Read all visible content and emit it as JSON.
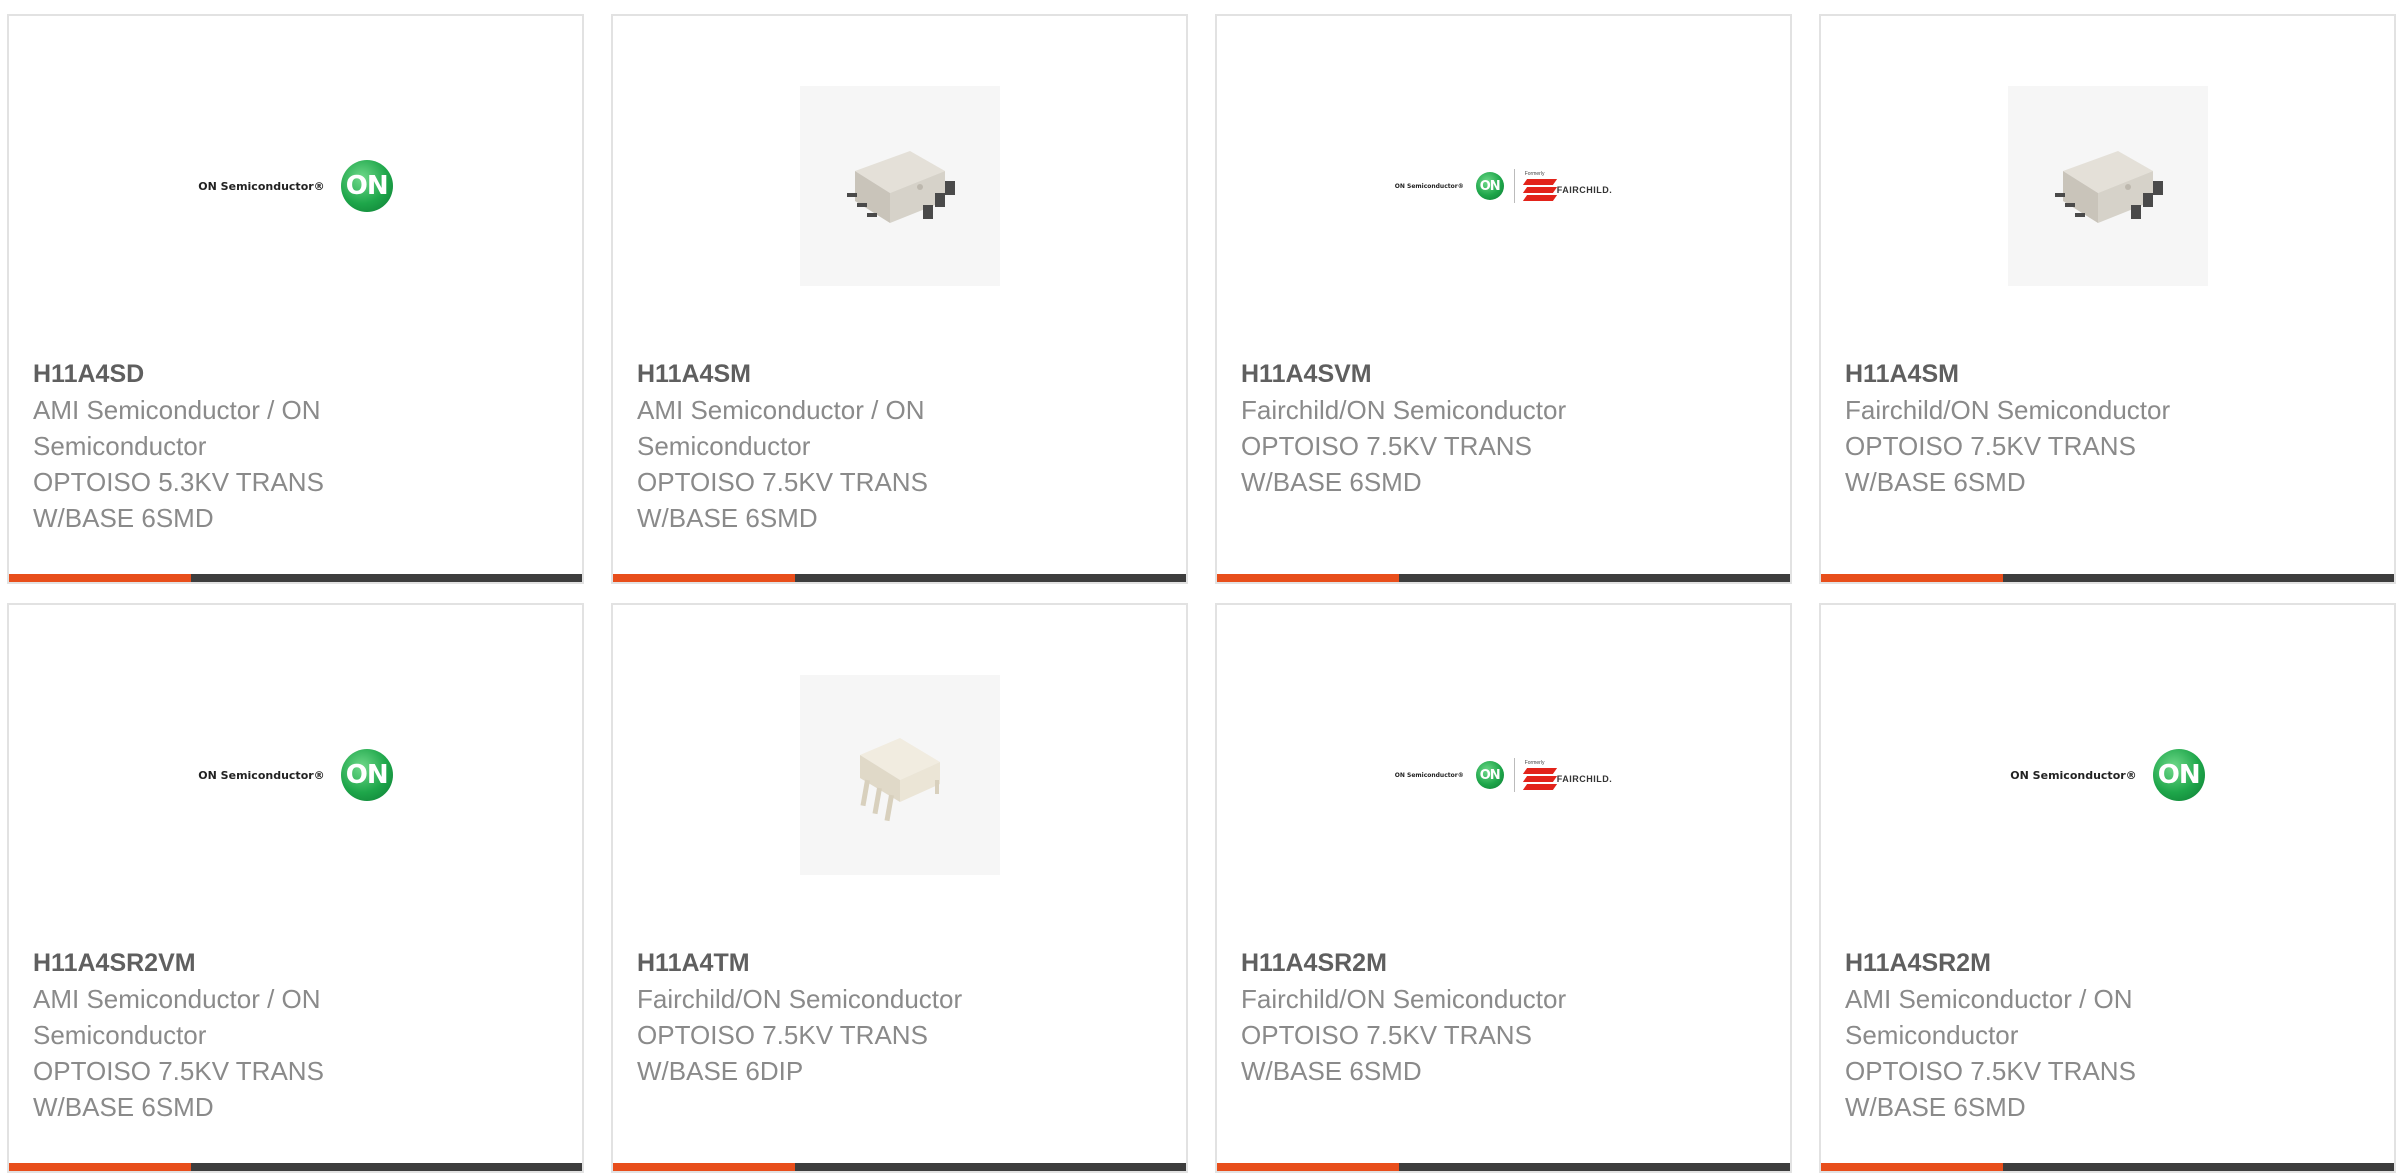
{
  "cards": [
    {
      "part_number": "H11A4SD",
      "manufacturer": "AMI Semiconductor / ON Semiconductor",
      "description": "OPTOISO 5.3KV TRANS W/BASE 6SMD",
      "logo_text": "ON Semiconductor®",
      "logo_mark": "ON"
    },
    {
      "part_number": "H11A4SM",
      "manufacturer": "AMI Semiconductor / ON Semiconductor",
      "description": "OPTOISO 7.5KV TRANS W/BASE 6SMD"
    },
    {
      "part_number": "H11A4SVM",
      "manufacturer": "Fairchild/ON Semiconductor",
      "description": "OPTOISO 7.5KV TRANS W/BASE 6SMD",
      "logo_text": "ON Semiconductor®",
      "logo_mark": "ON",
      "formerly": "Formerly",
      "fairchild": "FAIRCHILD."
    },
    {
      "part_number": "H11A4SM",
      "manufacturer": "Fairchild/ON Semiconductor",
      "description": "OPTOISO 7.5KV TRANS W/BASE 6SMD"
    },
    {
      "part_number": "H11A4SR2VM",
      "manufacturer": "AMI Semiconductor / ON Semiconductor",
      "description": "OPTOISO 7.5KV TRANS W/BASE 6SMD",
      "logo_text": "ON Semiconductor®",
      "logo_mark": "ON"
    },
    {
      "part_number": "H11A4TM",
      "manufacturer": "Fairchild/ON Semiconductor",
      "description": "OPTOISO 7.5KV TRANS W/BASE 6DIP"
    },
    {
      "part_number": "H11A4SR2M",
      "manufacturer": "Fairchild/ON Semiconductor",
      "description": "OPTOISO 7.5KV TRANS W/BASE 6SMD",
      "logo_text": "ON Semiconductor®",
      "logo_mark": "ON",
      "formerly": "Formerly",
      "fairchild": "FAIRCHILD."
    },
    {
      "part_number": "H11A4SR2M",
      "manufacturer": "AMI Semiconductor / ON Semiconductor",
      "description": "OPTOISO 7.5KV TRANS W/BASE 6SMD",
      "logo_text": "ON Semiconductor®",
      "logo_mark": "ON"
    }
  ],
  "colors": {
    "accent_bar": "#e84e1b",
    "dark_bar": "#3d3d3d",
    "on_green": "#1ea64a",
    "fairchild_red": "#e2231a"
  }
}
